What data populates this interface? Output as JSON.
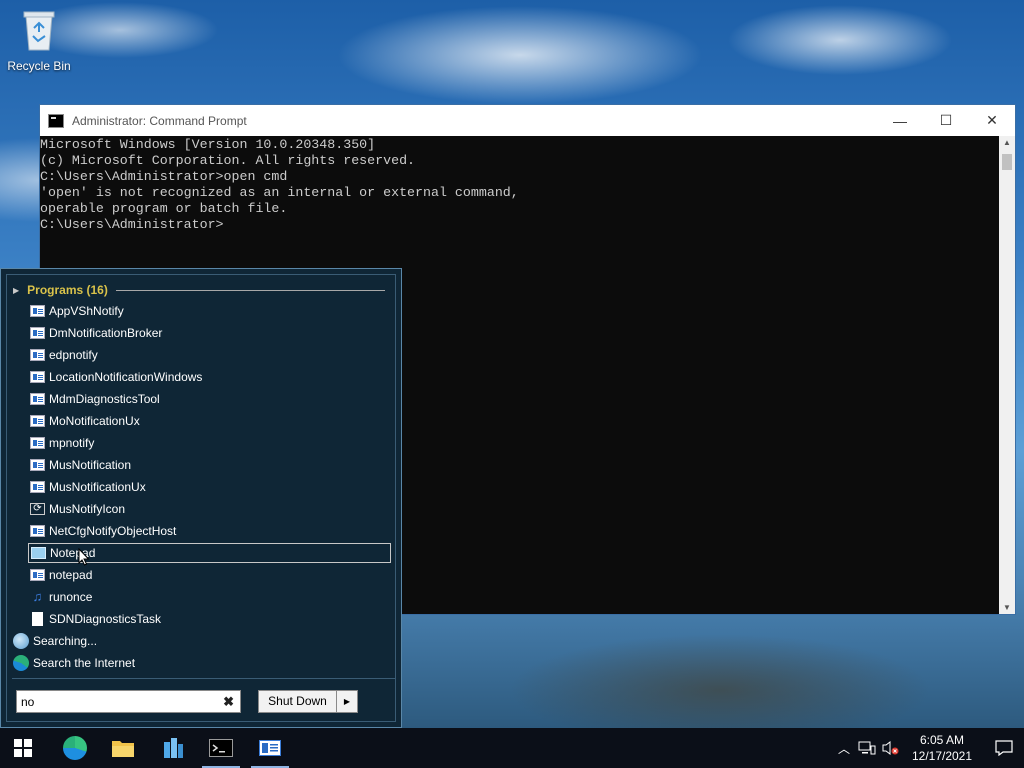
{
  "desktop": {
    "recycle_bin_label": "Recycle Bin"
  },
  "cmd": {
    "title": "Administrator: Command Prompt",
    "lines": [
      "Microsoft Windows [Version 10.0.20348.350]",
      "(c) Microsoft Corporation. All rights reserved.",
      "",
      "C:\\Users\\Administrator>open cmd",
      "'open' is not recognized as an internal or external command,",
      "operable program or batch file.",
      "",
      "C:\\Users\\Administrator>"
    ]
  },
  "start_menu": {
    "programs_header": "Programs (16)",
    "items": [
      {
        "label": "AppVShNotify",
        "icon": "app-window-icon"
      },
      {
        "label": "DmNotificationBroker",
        "icon": "app-window-icon"
      },
      {
        "label": "edpnotify",
        "icon": "app-window-icon"
      },
      {
        "label": "LocationNotificationWindows",
        "icon": "app-window-icon"
      },
      {
        "label": "MdmDiagnosticsTool",
        "icon": "app-window-icon"
      },
      {
        "label": "MoNotificationUx",
        "icon": "app-window-icon"
      },
      {
        "label": "mpnotify",
        "icon": "app-window-icon"
      },
      {
        "label": "MusNotification",
        "icon": "app-window-icon"
      },
      {
        "label": "MusNotificationUx",
        "icon": "app-window-icon"
      },
      {
        "label": "MusNotifyIcon",
        "icon": "sync-icon"
      },
      {
        "label": "NetCfgNotifyObjectHost",
        "icon": "app-window-icon"
      },
      {
        "label": "Notepad",
        "icon": "notepad-icon",
        "selected": true
      },
      {
        "label": "notepad",
        "icon": "app-window-icon"
      },
      {
        "label": "runonce",
        "icon": "music-note-icon"
      },
      {
        "label": "SDNDiagnosticsTask",
        "icon": "document-icon"
      }
    ],
    "searching_label": "Searching...",
    "search_internet_label": "Search the Internet",
    "search_value": "no",
    "shutdown_label": "Shut Down"
  },
  "taskbar": {
    "apps": [
      "start-icon",
      "edge-icon",
      "file-explorer-icon",
      "server-manager-icon",
      "command-prompt-icon",
      "app-window-icon"
    ],
    "time": "6:05 AM",
    "date": "12/17/2021"
  }
}
